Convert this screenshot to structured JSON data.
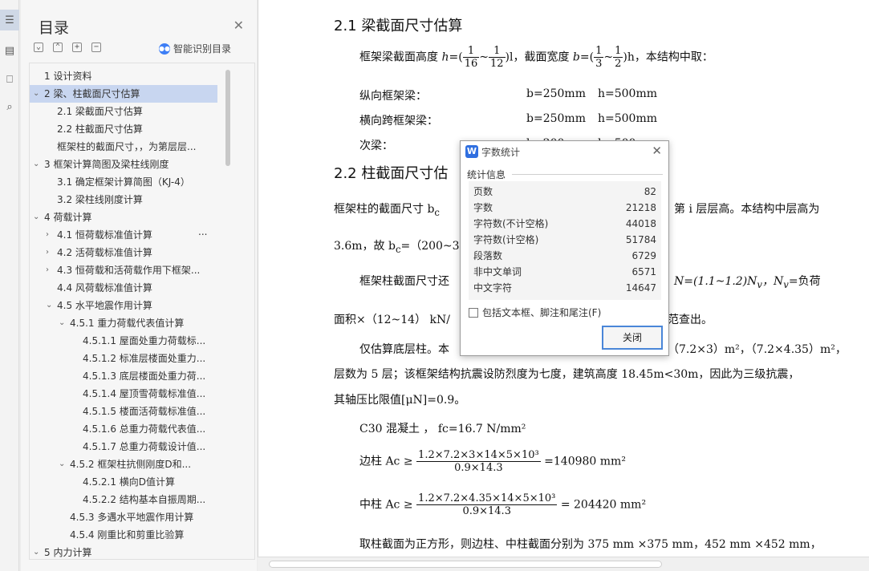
{
  "toc": {
    "title": "目录",
    "controls": [
      "⌄",
      "⌃",
      "+",
      "−"
    ],
    "smart_label": "智能识别目录",
    "items": [
      {
        "label": "1 设计资料",
        "twisty": ""
      },
      {
        "label": "2 梁、柱截面尺寸估算",
        "twisty": "⌄"
      },
      {
        "label": "2.1 梁截面尺寸估算",
        "twisty": ""
      },
      {
        "label": "2.2 柱截面尺寸估算",
        "twisty": ""
      },
      {
        "label": "框架柱的截面尺寸，，为第层层...",
        "twisty": ""
      },
      {
        "label": "3 框架计算简图及梁柱线刚度",
        "twisty": "⌄"
      },
      {
        "label": "3.1 确定框架计算简图（KJ-4）",
        "twisty": ""
      },
      {
        "label": "3.2 梁柱线刚度计算",
        "twisty": ""
      },
      {
        "label": "4 荷载计算",
        "twisty": "⌄"
      },
      {
        "label": "4.1 恒荷载标准值计算",
        "twisty": "›"
      },
      {
        "label": "4.2 活荷载标准值计算",
        "twisty": "›"
      },
      {
        "label": "4.3 恒荷载和活荷载作用下框架...",
        "twisty": "›"
      },
      {
        "label": "4.4 风荷载标准值计算",
        "twisty": ""
      },
      {
        "label": "4.5 水平地震作用计算",
        "twisty": "⌄"
      },
      {
        "label": "4.5.1 重力荷载代表值计算",
        "twisty": "⌄"
      },
      {
        "label": "4.5.1.1 屋面处重力荷载标...",
        "twisty": ""
      },
      {
        "label": "4.5.1.2 标准层楼面处重力...",
        "twisty": ""
      },
      {
        "label": "4.5.1.3 底层楼面处重力荷...",
        "twisty": ""
      },
      {
        "label": "4.5.1.4 屋顶雪荷载标准值...",
        "twisty": ""
      },
      {
        "label": "4.5.1.5 楼面活荷载标准值...",
        "twisty": ""
      },
      {
        "label": "4.5.1.6 总重力荷载代表值...",
        "twisty": ""
      },
      {
        "label": "4.5.1.7 总重力荷载设计值...",
        "twisty": ""
      },
      {
        "label": "4.5.2 框架柱抗侧刚度D和...",
        "twisty": "⌄"
      },
      {
        "label": "4.5.2.1 横向D值计算",
        "twisty": ""
      },
      {
        "label": "4.5.2.2 结构基本自振周期...",
        "twisty": ""
      },
      {
        "label": "4.5.3 多遇水平地震作用计算",
        "twisty": ""
      },
      {
        "label": "4.5.4 刚重比和剪重比验算",
        "twisty": ""
      },
      {
        "label": "5 内力计算",
        "twisty": "⌄"
      }
    ],
    "more_dots": "..."
  },
  "doc": {
    "h21": "2.1 梁截面尺寸估算",
    "p1_a": "框架梁截面高度",
    "p1_h": "h",
    "p1_eq": "=(",
    "p1_f1n": "1",
    "p1_f1d": "16",
    "p1_tilde": "~",
    "p1_f2n": "1",
    "p1_f2d": "12",
    "p1_l": ")l，截面宽度",
    "p1_b": "b",
    "p1_f3n": "1",
    "p1_f3d": "3",
    "p1_f4n": "1",
    "p1_f4d": "2",
    "p1_end": ")h，本结构中取：",
    "r1_label": "纵向框架梁：",
    "r1_b": "b=250mm",
    "r1_h": "h=500mm",
    "r2_label": "横向跨框架梁：",
    "r2_b": "b=250mm",
    "r2_h": "h=500mm",
    "r3_label": "次梁：",
    "r3_b": "b=200mm",
    "r3_h": "h=500mm",
    "h22": "2.2 柱截面尺寸估",
    "p2_a": "框架柱的截面尺寸 b",
    "p2_a2": "c",
    "p2_b": "第 i 层层高。本结构中层高为",
    "p3_a": "3.6m，故 b",
    "p3_a2": "c",
    "p3_b": "=（200~300",
    "p4_a": "框架柱截面尺寸还",
    "p4_b": "N=(1.1~1.2)N",
    "p4_c": "v",
    "p4_d": "，N",
    "p4_e": "v",
    "p4_f": "=负荷",
    "p5_a": "面积×（12~14） kN/",
    "p5_b": "范查出。",
    "p6_a": "仅估算底层柱。本",
    "p6_b": "（7.2×3）m²，（7.2×4.35）m²，",
    "p7": "层数为 5 层；该框架结构抗震设防烈度为七度，建筑高度 18.45m<30m，因此为三级抗震，",
    "p8": "其轴压比限值[μN]=0.9。",
    "p9": "C30 混凝土 ， fc=16.7 N/mm²",
    "p10_a": "边柱 Ac ≥",
    "p10_n": "1.2×7.2×3×14×5×10³",
    "p10_d": "0.9×14.3",
    "p10_r": "=140980 mm²",
    "p11_a": "中柱 Ac ≥",
    "p11_n": "1.2×7.2×4.35×14×5×10³",
    "p11_d": "0.9×14.3",
    "p11_r": "= 204420 mm²",
    "p12": "取柱截面为正方形，则边柱、中柱截面分别为 375 mm ×375 mm，452 mm ×452 mm，"
  },
  "dialog": {
    "title": "字数统计",
    "logo": "W",
    "section": "统计信息",
    "stats": [
      {
        "k": "页数",
        "v": "82"
      },
      {
        "k": "字数",
        "v": "21218"
      },
      {
        "k": "字符数(不计空格)",
        "v": "44018"
      },
      {
        "k": "字符数(计空格)",
        "v": "51784"
      },
      {
        "k": "段落数",
        "v": "6729"
      },
      {
        "k": "非中文单词",
        "v": "6571"
      },
      {
        "k": "中文字符",
        "v": "14647"
      }
    ],
    "checkbox_label": "包括文本框、脚注和尾注(F)",
    "checkbox_checked": false,
    "ok_label": "关闭"
  }
}
